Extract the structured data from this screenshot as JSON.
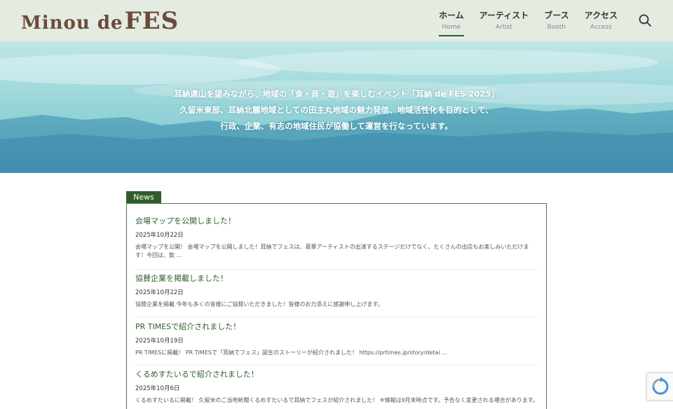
{
  "header": {
    "logo": {
      "part1": "Minou de ",
      "part2": "FES"
    },
    "nav": [
      {
        "ja": "ホーム",
        "en": "Home"
      },
      {
        "ja": "アーティスト",
        "en": "Artist"
      },
      {
        "ja": "ブース",
        "en": "Booth"
      },
      {
        "ja": "アクセス",
        "en": "Access"
      }
    ],
    "search_icon": "search-icon",
    "active_color": "#2f5d2a"
  },
  "hero": {
    "lines": [
      "耳納連山を望みながら、地域の「食・音・遊」を楽しむイベント「耳納 de FES 2025」",
      "久留米東部、耳納北麓地域としての田主丸地域の魅力発信、地域活性化を目的として、",
      "行政、企業、有志の地域住民が協働して運営を行なっています。"
    ]
  },
  "news": {
    "label": "News",
    "items": [
      {
        "title": "会場マップを公開しました！",
        "date": "2025年10月22日",
        "excerpt": "会場マップを公開！ 会場マップを公開しました！耳納でフェスは、豪華アーティストの出演するステージだけでなく、たくさんの出店もお楽しみいただけます！今回は、飲 …"
      },
      {
        "title": "協賛企業を掲載しました！",
        "date": "2025年10月22日",
        "excerpt": "協賛企業を掲載 今年も多くの皆様にご協賛いただきました！皆様のお力添えに感謝申し上げます。"
      },
      {
        "title": "PR TIMESで紹介されました！",
        "date": "2025年10月19日",
        "excerpt": "PR TIMESに掲載！ PR TIMESで「耳納でフェス」誕生のストーリーが紹介されました！ https://prtimes.jp/story/detai …"
      },
      {
        "title": "くるめすたいるで紹介されました！",
        "date": "2025年10月6日",
        "excerpt": "くるめすたいるに掲載！ 久留米のご当地新聞くるめすたいるで耳納でフェスが紹介されました！ ※情報は9月末時点です。予告なく変更される場合があります。"
      }
    ]
  }
}
